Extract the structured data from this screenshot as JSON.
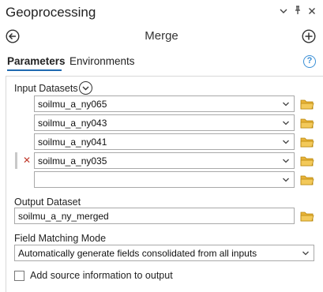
{
  "panel": {
    "title": "Geoprocessing",
    "tool_name": "Merge",
    "tabs": [
      {
        "label": "Parameters",
        "active": true
      },
      {
        "label": "Environments",
        "active": false
      }
    ],
    "help_glyph": "?"
  },
  "input_datasets": {
    "label": "Input Datasets",
    "items": [
      {
        "value": "soilmu_a_ny065"
      },
      {
        "value": "soilmu_a_ny043"
      },
      {
        "value": "soilmu_a_ny041"
      },
      {
        "value": "soilmu_a_ny035",
        "remove_glyph": "✕"
      },
      {
        "value": ""
      }
    ]
  },
  "output_dataset": {
    "label": "Output Dataset",
    "value": "soilmu_a_ny_merged"
  },
  "field_matching": {
    "label": "Field Matching Mode",
    "value": "Automatically generate fields consolidated from all inputs"
  },
  "add_source": {
    "label": "Add source information to output",
    "checked": false
  },
  "colors": {
    "accent": "#1f6ab1",
    "help": "#3a8fd6",
    "folder": "#e8b339",
    "remove": "#c0392b"
  }
}
